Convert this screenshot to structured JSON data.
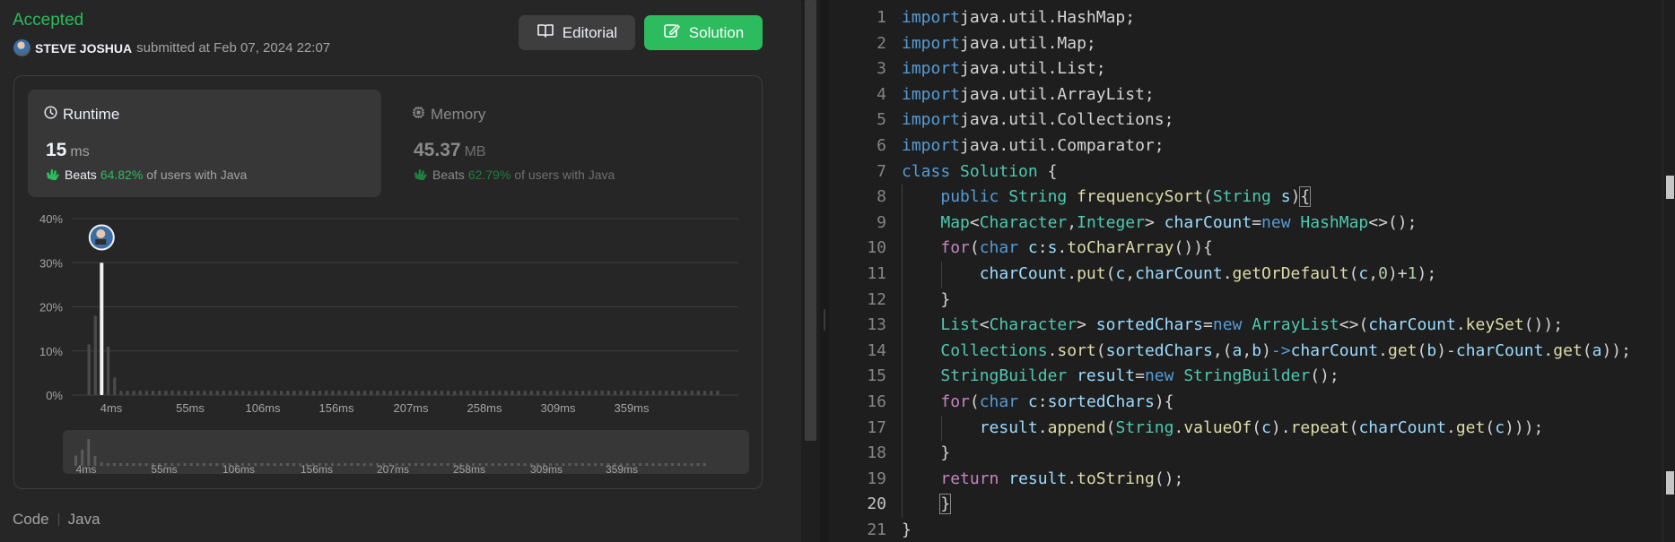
{
  "submission": {
    "status": "Accepted",
    "username": "STEVE JOSHUA",
    "submitted_text": "submitted at Feb 07, 2024 22:07"
  },
  "buttons": {
    "editorial": "Editorial",
    "solution": "Solution"
  },
  "runtime": {
    "title": "Runtime",
    "value": "15",
    "unit": "ms",
    "beats_word": "Beats",
    "beats_pct": "64.82%",
    "beats_suffix": "of users with Java"
  },
  "memory": {
    "title": "Memory",
    "value": "45.37",
    "unit": "MB",
    "beats_word": "Beats",
    "beats_pct": "62.79%",
    "beats_suffix": "of users with Java"
  },
  "code_section": {
    "label": "Code",
    "language": "Java"
  },
  "colors": {
    "accent": "#2cbb5d",
    "panel": "#262626",
    "card": "#373737",
    "editor_bg": "#1e1e1e"
  },
  "icons": [
    "clock-icon",
    "memory-chip-icon",
    "book-icon",
    "edit-icon",
    "clap-icon"
  ],
  "chart_data": {
    "type": "bar",
    "ylabel": "",
    "xlabel": "",
    "yticks": [
      "40%",
      "30%",
      "20%",
      "10%",
      "0%"
    ],
    "ylim": [
      0,
      40
    ],
    "xtick_labels": [
      "4ms",
      "55ms",
      "106ms",
      "156ms",
      "207ms",
      "258ms",
      "309ms",
      "359ms"
    ],
    "values": [
      11.5,
      18,
      30,
      11,
      4,
      1,
      1,
      1,
      1,
      1,
      1,
      1,
      1,
      1,
      1,
      1,
      1,
      1,
      1,
      1,
      1,
      1,
      1,
      1,
      1,
      1,
      1,
      1,
      1,
      1,
      1,
      1,
      1,
      1,
      1,
      1,
      1,
      1,
      1,
      1,
      1,
      1,
      1,
      1,
      1,
      1,
      1,
      1,
      1,
      1,
      1,
      1,
      1,
      1,
      1,
      1,
      1,
      1,
      1,
      1,
      1,
      1,
      1,
      1,
      1,
      1,
      1,
      1,
      1,
      1,
      1,
      1,
      1,
      1,
      1,
      1,
      1,
      1,
      1,
      1,
      1,
      1,
      1,
      1,
      1,
      1,
      1,
      1,
      1,
      1,
      1,
      1,
      1,
      1,
      1,
      1,
      1,
      1,
      1
    ],
    "highlight_index": 2,
    "grid": true
  },
  "editor": {
    "current_line": 20,
    "lines": [
      [
        [
          "kw",
          "import"
        ],
        [
          "",
          "java.util.HashMap;"
        ]
      ],
      [
        [
          "kw",
          "import"
        ],
        [
          "",
          "java.util.Map;"
        ]
      ],
      [
        [
          "kw",
          "import"
        ],
        [
          "",
          "java.util.List;"
        ]
      ],
      [
        [
          "kw",
          "import"
        ],
        [
          "",
          "java.util.ArrayList;"
        ]
      ],
      [
        [
          "kw",
          "import"
        ],
        [
          "",
          "java.util.Collections;"
        ]
      ],
      [
        [
          "kw",
          "import"
        ],
        [
          "",
          "java.util.Comparator;"
        ]
      ],
      [
        [
          "kw",
          "class"
        ],
        [
          "",
          " "
        ],
        [
          "ty",
          "Solution"
        ],
        [
          "",
          " {"
        ]
      ],
      [
        [
          "",
          "    "
        ],
        [
          "kw",
          "public"
        ],
        [
          "",
          " "
        ],
        [
          "ty",
          "String"
        ],
        [
          "",
          " "
        ],
        [
          "fn",
          "frequencySort"
        ],
        [
          "",
          "("
        ],
        [
          "ty",
          "String"
        ],
        [
          "",
          " "
        ],
        [
          "va",
          "s"
        ],
        [
          "",
          ")"
        ],
        [
          "bh",
          "{"
        ]
      ],
      [
        [
          "",
          "    "
        ],
        [
          "ty",
          "Map"
        ],
        [
          "",
          "<"
        ],
        [
          "ty",
          "Character"
        ],
        [
          "",
          ","
        ],
        [
          "ty",
          "Integer"
        ],
        [
          "",
          "> "
        ],
        [
          "va",
          "charCount"
        ],
        [
          "",
          "="
        ],
        [
          "kw",
          "new"
        ],
        [
          "",
          " "
        ],
        [
          "ty",
          "HashMap"
        ],
        [
          "",
          "<>();"
        ]
      ],
      [
        [
          "",
          "    "
        ],
        [
          "kw2",
          "for"
        ],
        [
          "",
          "("
        ],
        [
          "kw",
          "char"
        ],
        [
          "",
          " "
        ],
        [
          "va",
          "c"
        ],
        [
          "",
          ":"
        ],
        [
          "va",
          "s"
        ],
        [
          "",
          "."
        ],
        [
          "fn",
          "toCharArray"
        ],
        [
          "",
          "()){"
        ]
      ],
      [
        [
          "",
          "        "
        ],
        [
          "va",
          "charCount"
        ],
        [
          "",
          "."
        ],
        [
          "fn",
          "put"
        ],
        [
          "",
          "("
        ],
        [
          "va",
          "c"
        ],
        [
          "",
          ","
        ],
        [
          "va",
          "charCount"
        ],
        [
          "",
          "."
        ],
        [
          "fn",
          "getOrDefault"
        ],
        [
          "",
          "("
        ],
        [
          "va",
          "c"
        ],
        [
          "",
          ","
        ],
        [
          "nu",
          "0"
        ],
        [
          "",
          ")+"
        ],
        [
          "nu",
          "1"
        ],
        [
          "",
          ");"
        ]
      ],
      [
        [
          "",
          "    }"
        ]
      ],
      [
        [
          "",
          "    "
        ],
        [
          "ty",
          "List"
        ],
        [
          "",
          "<"
        ],
        [
          "ty",
          "Character"
        ],
        [
          "",
          "> "
        ],
        [
          "va",
          "sortedChars"
        ],
        [
          "",
          "="
        ],
        [
          "kw",
          "new"
        ],
        [
          "",
          " "
        ],
        [
          "ty",
          "ArrayList"
        ],
        [
          "",
          "<>("
        ],
        [
          "va",
          "charCount"
        ],
        [
          "",
          "."
        ],
        [
          "fn",
          "keySet"
        ],
        [
          "",
          "());"
        ]
      ],
      [
        [
          "",
          "    "
        ],
        [
          "ty",
          "Collections"
        ],
        [
          "",
          "."
        ],
        [
          "fn",
          "sort"
        ],
        [
          "",
          "("
        ],
        [
          "va",
          "sortedChars"
        ],
        [
          "",
          ",("
        ],
        [
          "va",
          "a"
        ],
        [
          "",
          ","
        ],
        [
          "va",
          "b"
        ],
        [
          "",
          ")"
        ],
        [
          "kw",
          "->"
        ],
        [
          "va",
          "charCount"
        ],
        [
          "",
          "."
        ],
        [
          "fn",
          "get"
        ],
        [
          "",
          "("
        ],
        [
          "va",
          "b"
        ],
        [
          "",
          ")-"
        ],
        [
          "va",
          "charCount"
        ],
        [
          "",
          "."
        ],
        [
          "fn",
          "get"
        ],
        [
          "",
          "("
        ],
        [
          "va",
          "a"
        ],
        [
          "",
          "));"
        ]
      ],
      [
        [
          "",
          "    "
        ],
        [
          "ty",
          "StringBuilder"
        ],
        [
          "",
          " "
        ],
        [
          "va",
          "result"
        ],
        [
          "",
          "="
        ],
        [
          "kw",
          "new"
        ],
        [
          "",
          " "
        ],
        [
          "ty",
          "StringBuilder"
        ],
        [
          "",
          "();"
        ]
      ],
      [
        [
          "",
          "    "
        ],
        [
          "kw2",
          "for"
        ],
        [
          "",
          "("
        ],
        [
          "kw",
          "char"
        ],
        [
          "",
          " "
        ],
        [
          "va",
          "c"
        ],
        [
          "",
          ":"
        ],
        [
          "va",
          "sortedChars"
        ],
        [
          "",
          "){"
        ]
      ],
      [
        [
          "",
          "        "
        ],
        [
          "va",
          "result"
        ],
        [
          "",
          "."
        ],
        [
          "fn",
          "append"
        ],
        [
          "",
          "("
        ],
        [
          "ty",
          "String"
        ],
        [
          "",
          "."
        ],
        [
          "fn",
          "valueOf"
        ],
        [
          "",
          "("
        ],
        [
          "va",
          "c"
        ],
        [
          "",
          ")."
        ],
        [
          "fn",
          "repeat"
        ],
        [
          "",
          "("
        ],
        [
          "va",
          "charCount"
        ],
        [
          "",
          "."
        ],
        [
          "fn",
          "get"
        ],
        [
          "",
          "("
        ],
        [
          "va",
          "c"
        ],
        [
          "",
          ")));"
        ]
      ],
      [
        [
          "",
          "    }"
        ]
      ],
      [
        [
          "",
          "    "
        ],
        [
          "kw2",
          "return"
        ],
        [
          "",
          " "
        ],
        [
          "va",
          "result"
        ],
        [
          "",
          "."
        ],
        [
          "fn",
          "toString"
        ],
        [
          "",
          "();"
        ]
      ],
      [
        [
          "",
          "    "
        ],
        [
          "bh",
          "}"
        ]
      ],
      [
        [
          "",
          "}"
        ]
      ]
    ]
  }
}
